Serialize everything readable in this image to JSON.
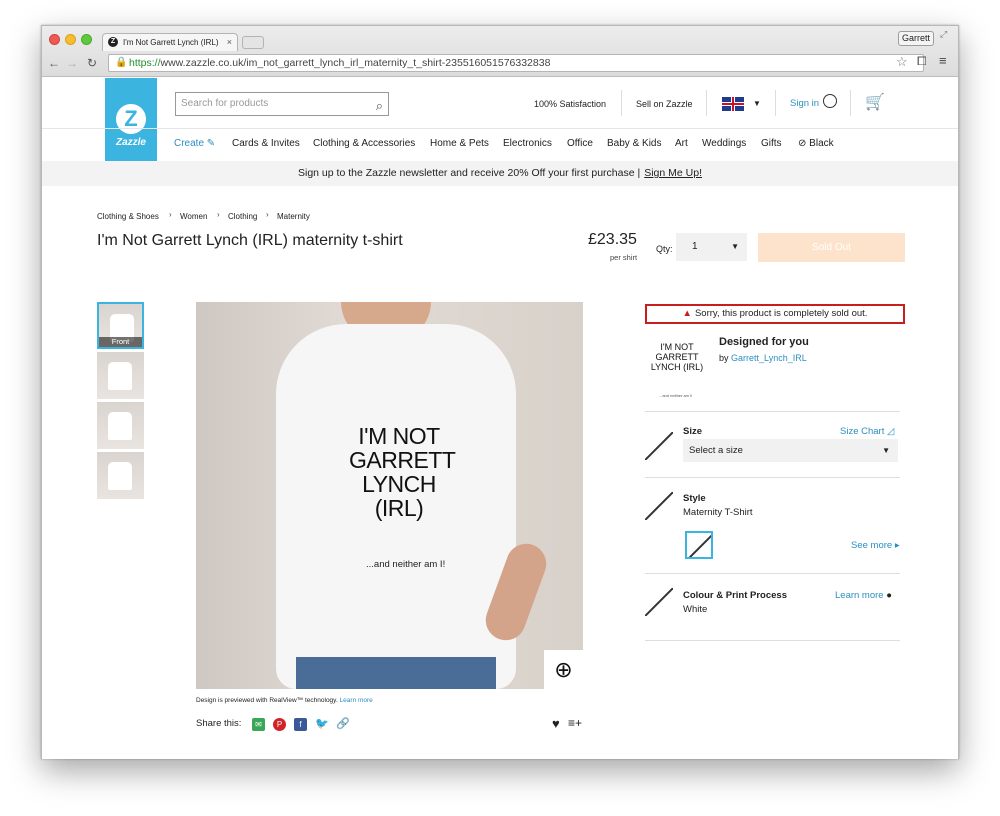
{
  "browser": {
    "tab_title": "I'm Not Garrett Lynch (IRL)",
    "tab_close": "×",
    "profile": "Garrett",
    "url_https": "https://",
    "url_rest": "www.zazzle.co.uk/im_not_garrett_lynch_irl_maternity_t_shirt-235516051576332838"
  },
  "header": {
    "logo_text": "Zazzle",
    "search_placeholder": "Search for products",
    "satisfaction": "100% Satisfaction",
    "sell": "Sell on Zazzle",
    "signin": "Sign in"
  },
  "nav": {
    "create": "Create",
    "items": [
      "Cards & Invites",
      "Clothing & Accessories",
      "Home & Pets",
      "Electronics",
      "Office",
      "Baby & Kids",
      "Art",
      "Weddings",
      "Gifts",
      "Black"
    ]
  },
  "banner": {
    "text": "Sign up to the Zazzle newsletter and receive 20% Off your first purchase  |",
    "link": "Sign Me Up!"
  },
  "breadcrumb": [
    "Clothing & Shoes",
    "Women",
    "Clothing",
    "Maternity"
  ],
  "product": {
    "title": "I'm Not Garrett Lynch (IRL) maternity t-shirt",
    "price": "£23.35",
    "per_unit": "per shirt",
    "qty_label": "Qty:",
    "qty_value": "1",
    "sold_out_button": "Sold Out",
    "thumb_front_label": "Front",
    "print_line1": "I'M NOT",
    "print_line2": "GARRETT",
    "print_line3": "LYNCH (IRL)",
    "print_sub": "...and neither am I!",
    "realview_text": "Design is previewed with RealView™ technology.",
    "realview_link": "Learn more",
    "share_label": "Share this:"
  },
  "sidebar": {
    "sold_out_msg": "Sorry, this product is completely sold out.",
    "design_img_text": "I'M NOT GARRETT LYNCH (IRL)",
    "design_img_tiny": "...and neither am I!",
    "designed_for_you": "Designed for you",
    "by": "by",
    "designer": "Garrett_Lynch_IRL",
    "size_label": "Size",
    "size_chart": "Size Chart",
    "size_select": "Select a size",
    "style_label": "Style",
    "style_value": "Maternity T-Shirt",
    "see_more": "See more ▸",
    "colour_label": "Colour & Print Process",
    "colour_value": "White",
    "learn_more": "Learn more"
  },
  "colors": {
    "brand": "#3bb5e0",
    "link": "#2b8fc2",
    "error": "#c81e1e",
    "sold_out_bg": "#fde3cc"
  }
}
